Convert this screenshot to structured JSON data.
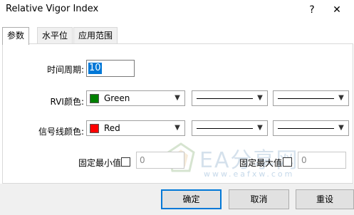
{
  "window": {
    "title": "Relative Vigor Index",
    "help_label": "?",
    "close_label": "✕"
  },
  "tabs": [
    {
      "label": "参数",
      "active": true
    },
    {
      "label": "水平位",
      "active": false
    },
    {
      "label": "应用范围",
      "active": false
    }
  ],
  "params": {
    "period_label": "时间周期:",
    "period_value": "10",
    "rvi_color_label": "RVI颜色:",
    "rvi_color": {
      "name": "Green",
      "hex": "#008000"
    },
    "signal_color_label": "信号线颜色:",
    "signal_color": {
      "name": "Red",
      "hex": "#ff0000"
    },
    "fixed_min_label": "固定最小值",
    "fixed_min_value": "0",
    "fixed_max_label": "固定最大值",
    "fixed_max_value": "0"
  },
  "watermark": {
    "text": "EA分享网",
    "url": "www.eafxw.com"
  },
  "buttons": {
    "ok": "确定",
    "cancel": "取消",
    "reset": "重设"
  }
}
